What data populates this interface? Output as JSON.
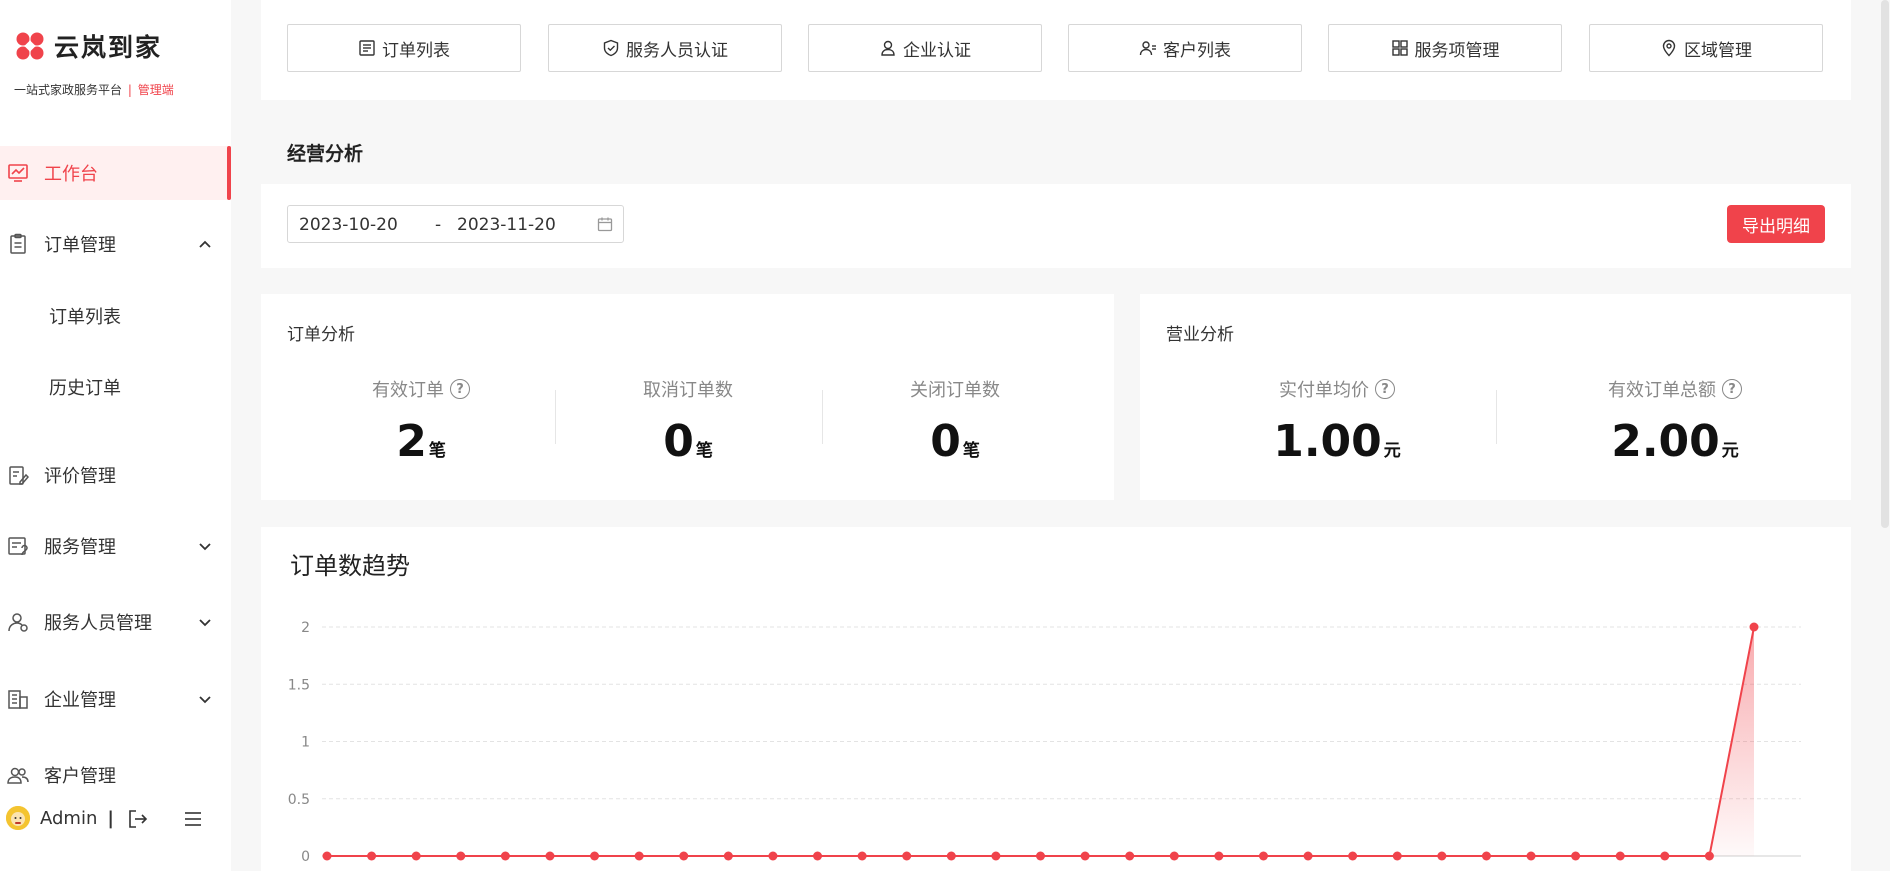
{
  "brand": {
    "name": "云岚到家",
    "subtitle": "一站式家政服务平台",
    "subtitle_sep": "|",
    "role": "管理端",
    "accent": "#f0434b"
  },
  "sidebar": {
    "items": [
      {
        "label": "工作台",
        "icon": "chart-monitor-icon",
        "active": true
      },
      {
        "label": "订单管理",
        "icon": "clipboard-icon",
        "expanded": true,
        "children": [
          {
            "label": "订单列表"
          },
          {
            "label": "历史订单"
          }
        ]
      },
      {
        "label": "评价管理",
        "icon": "edit-doc-icon"
      },
      {
        "label": "服务管理",
        "icon": "service-icon",
        "expanded": false
      },
      {
        "label": "服务人员管理",
        "icon": "staff-icon",
        "expanded": false
      },
      {
        "label": "企业管理",
        "icon": "building-icon",
        "expanded": false
      },
      {
        "label": "客户管理",
        "icon": "users-icon"
      }
    ],
    "user": {
      "name": "Admin",
      "sep": "|"
    }
  },
  "quick_links": [
    {
      "label": "订单列表",
      "icon": "list-icon"
    },
    {
      "label": "服务人员认证",
      "icon": "shield-icon"
    },
    {
      "label": "企业认证",
      "icon": "person-icon"
    },
    {
      "label": "客户列表",
      "icon": "customer-icon"
    },
    {
      "label": "服务项管理",
      "icon": "grid-icon"
    },
    {
      "label": "区域管理",
      "icon": "location-icon"
    }
  ],
  "analysis": {
    "title": "经营分析",
    "date_start": "2023-10-20",
    "date_sep": "-",
    "date_end": "2023-11-20",
    "export_label": "导出明细"
  },
  "order_analysis": {
    "title": "订单分析",
    "metrics": [
      {
        "label": "有效订单",
        "value": "2",
        "unit": "笔",
        "help": true
      },
      {
        "label": "取消订单数",
        "value": "0",
        "unit": "笔",
        "help": false
      },
      {
        "label": "关闭订单数",
        "value": "0",
        "unit": "笔",
        "help": false
      }
    ]
  },
  "revenue_analysis": {
    "title": "营业分析",
    "metrics": [
      {
        "label": "实付单均价",
        "value": "1.00",
        "unit": "元",
        "help": true
      },
      {
        "label": "有效订单总额",
        "value": "2.00",
        "unit": "元",
        "help": true
      }
    ]
  },
  "chart_data": {
    "type": "area",
    "title": "订单数趋势",
    "y_ticks": [
      "0",
      "0.5",
      "1",
      "1.5",
      "2"
    ],
    "ylim": [
      0,
      2
    ],
    "grid": true,
    "color": "#f0434b",
    "series": [
      {
        "values": [
          0,
          0,
          0,
          0,
          0,
          0,
          0,
          0,
          0,
          0,
          0,
          0,
          0,
          0,
          0,
          0,
          0,
          0,
          0,
          0,
          0,
          0,
          0,
          0,
          0,
          0,
          0,
          0,
          0,
          0,
          0,
          0,
          2
        ]
      }
    ]
  }
}
